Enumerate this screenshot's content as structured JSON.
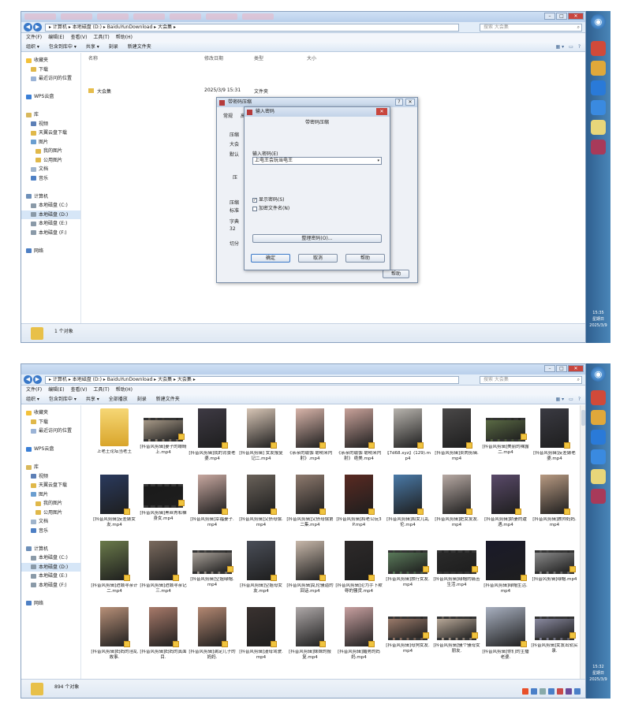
{
  "screen1": {
    "address": "▸ 计算机 ▸ 本地磁盘 (D:) ▸ BaiduYunDownload ▸ 大会集 ▸",
    "search_placeholder": "搜索 大会集",
    "menu": [
      "文件(F)",
      "编辑(E)",
      "查看(V)",
      "工具(T)",
      "帮助(H)"
    ],
    "toolbar": [
      "组织 ▾",
      "包含到库中 ▾",
      "共享 ▾",
      "刻录",
      "新建文件夹"
    ],
    "sidebar": [
      {
        "label": "收藏夹",
        "icon": "star-icon",
        "color": "#f3c13a"
      },
      {
        "label": "下载",
        "icon": "download-folder-icon",
        "color": "#e0b84a",
        "indent": true
      },
      {
        "label": "最近访问的位置",
        "icon": "recent-icon",
        "color": "#9ab3d6",
        "indent": true
      },
      {
        "label": "",
        "icon": "",
        "color": ""
      },
      {
        "label": "WPS云盘",
        "icon": "cloud-icon",
        "color": "#3a7fd6"
      },
      {
        "label": "",
        "icon": "",
        "color": ""
      },
      {
        "label": "库",
        "icon": "library-icon",
        "color": "#d8b85c"
      },
      {
        "label": "视频",
        "icon": "video-icon",
        "color": "#5c7fb6",
        "indent": true
      },
      {
        "label": "天翼云盘下载",
        "icon": "cloud-download-icon",
        "color": "#e0b84a",
        "indent": true
      },
      {
        "label": "图片",
        "icon": "picture-icon",
        "color": "#6a9ed0",
        "indent": true
      },
      {
        "label": "我的图片",
        "icon": "picture-folder-icon",
        "color": "#e0b84a",
        "indent2": true
      },
      {
        "label": "公用图片",
        "icon": "picture-folder-icon",
        "color": "#e0b84a",
        "indent2": true
      },
      {
        "label": "文档",
        "icon": "document-icon",
        "color": "#9fb4cc",
        "indent": true
      },
      {
        "label": "音乐",
        "icon": "music-icon",
        "color": "#4d7fc4",
        "indent": true
      },
      {
        "label": "",
        "icon": "",
        "color": ""
      },
      {
        "label": "计算机",
        "icon": "computer-icon",
        "color": "#6d8fb8"
      },
      {
        "label": "本地磁盘 (C:)",
        "icon": "drive-icon",
        "color": "#8a9aa8",
        "indent": true
      },
      {
        "label": "本地磁盘 (D:)",
        "icon": "drive-icon",
        "color": "#8a9aa8",
        "indent": true,
        "selected": true
      },
      {
        "label": "本地磁盘 (E:)",
        "icon": "drive-icon",
        "color": "#8a9aa8",
        "indent": true
      },
      {
        "label": "本地磁盘 (F:)",
        "icon": "drive-icon",
        "color": "#8a9aa8",
        "indent": true
      },
      {
        "label": "",
        "icon": "",
        "color": ""
      },
      {
        "label": "网络",
        "icon": "network-icon",
        "color": "#4d7fc4"
      }
    ],
    "columns": {
      "name": "名称",
      "date": "修改日期",
      "type": "类型",
      "size": "大小"
    },
    "row": {
      "name": "大会集",
      "date": "2025/3/9 15:31",
      "type": "文件夹"
    },
    "status": "1 个对象",
    "clock": {
      "time": "15:35",
      "day": "星期日",
      "date": "2025/3/9"
    },
    "dialog_back": {
      "title": "带密码压缩",
      "tab_general": "常规",
      "tab_advanced": "高",
      "labels": [
        "压缩",
        "大会",
        "默认",
        "压",
        "压缩",
        "标准",
        "字典",
        "32",
        "切分"
      ],
      "help": "帮助"
    },
    "dialog": {
      "title": "输入密码",
      "heading": "带密码压缩",
      "password_label": "输入密码(E)",
      "password_value": "上电王会玩当电王",
      "show_password": "显示密码(S)",
      "encrypt_names": "加密文件名(N)",
      "organize": "整理密码(O)...",
      "ok": "确定",
      "cancel": "取消",
      "help": "帮助"
    }
  },
  "screen2": {
    "address": "▸ 计算机 ▸ 本地磁盘 (D:) ▸ BaiduYunDownload ▸ 大会集 ▸ 大会集 ▸",
    "search_placeholder": "搜索 大会集",
    "menu": [
      "文件(F)",
      "编辑(E)",
      "查看(V)",
      "工具(T)",
      "帮助(H)"
    ],
    "toolbar": [
      "组织 ▾",
      "包含到库中 ▾",
      "共享 ▾",
      "全部播放",
      "刻录",
      "新建文件夹"
    ],
    "status": "894 个对象",
    "clock": {
      "time": "15:32",
      "day": "星期日",
      "date": "2025/3/9"
    },
    "files": [
      {
        "name": "上老王论坛当老王",
        "kind": "folder",
        "color": ""
      },
      {
        "name": "[抖音风剪辑]妻子的眼睛上.mp4",
        "kind": "wide",
        "color": "#a89a88"
      },
      {
        "name": "[抖音风剪辑]我的背景老婆.mp4",
        "kind": "tall",
        "color": "#3e3a44"
      },
      {
        "name": "[抖音风剪辑] 女友报复记二.mp4",
        "kind": "tall",
        "color": "#d8c6b6"
      },
      {
        "name": "《亲亲的瑜伽 聪明来内射》.mp4",
        "kind": "tall",
        "color": "#d9b5aa"
      },
      {
        "name": "《亲亲的瑜伽 聪明来内射》 绝美.mp4",
        "kind": "tall",
        "color": "#c9a29a"
      },
      {
        "name": "【7d68.xyz】(129).mp4",
        "kind": "tall",
        "color": "#b8b4ae"
      },
      {
        "name": "[抖音风剪辑]卖肉剪辑.mp4",
        "kind": "tall",
        "color": "#4a4848"
      },
      {
        "name": "[抖音风剪辑]美丽的裸露二.mp4",
        "kind": "wide",
        "color": "#5a6a44"
      },
      {
        "name": "[抖音风剪辑]反差婊老婆.mp4",
        "kind": "tall",
        "color": "#3a3a42"
      },
      {
        "name": "[抖音风剪辑]反差婊女友.mp4",
        "kind": "tall",
        "color": "#2a3a5e"
      },
      {
        "name": "[抖音风剪辑]黑丝秀和裸身女.mp4",
        "kind": "wide",
        "color": "#1a1a1a"
      },
      {
        "name": "[抖音风剪辑]幸福妻子.mp4",
        "kind": "tall",
        "color": "#c8a8a0"
      },
      {
        "name": "[抖音风剪辑]父债母偿.mp4",
        "kind": "tall",
        "color": "#6a625a"
      },
      {
        "name": "[抖音风剪辑]父债母偿第二集.mp4",
        "kind": "tall",
        "color": "#8e7a6e"
      },
      {
        "name": "[抖音风剪辑]和老公玩3P.mp4",
        "kind": "tall",
        "color": "#5a2a22"
      },
      {
        "name": "[抖音风剪辑]和女儿乱伦.mp4",
        "kind": "tall",
        "color": "#4a7aa8"
      },
      {
        "name": "[抖音风剪辑]肥女友友.mp4",
        "kind": "tall",
        "color": "#b8aaa4"
      },
      {
        "name": "[抖音风剪辑]娇妻的遭遇.mp4",
        "kind": "tall",
        "color": "#5a4a6a"
      },
      {
        "name": "[抖音风剪辑]教师妈妈.mp4",
        "kind": "tall",
        "color": "#b89a82"
      },
      {
        "name": "[抖音风剪辑]进城寻亲计二.mp4",
        "kind": "tall",
        "color": "#6a7a4a"
      },
      {
        "name": "[抖音风剪辑]进城寻亲记三.mp4",
        "kind": "tall",
        "color": "#7a6a5e"
      },
      {
        "name": "[抖音风剪辑]空姐绿帽.mp4",
        "kind": "wide",
        "color": "#a8a098"
      },
      {
        "name": "[抖音风剪辑]空姐母女友.mp4",
        "kind": "tall",
        "color": "#4a4e58"
      },
      {
        "name": "[抖音风剪辑]乱伦骚逼的回话.mp4",
        "kind": "tall",
        "color": "#c8b8aa"
      },
      {
        "name": "[抖音风剪辑]沦为手下欺辱的骚货.mp4",
        "kind": "tall",
        "color": "#2e2a2a"
      },
      {
        "name": "[抖音风剪辑]旅行女友.mp4",
        "kind": "wide",
        "color": "#5a7a5a"
      },
      {
        "name": "[抖音风剪辑]绿帽的痛苦生活.mp4",
        "kind": "wide",
        "color": "#2a2a2a"
      },
      {
        "name": "[抖音风剪辑]绿帽生活.mp4",
        "kind": "sq",
        "color": "#1a1a2a"
      },
      {
        "name": "[抖音风剪辑]绿帽.mp4",
        "kind": "wide",
        "color": "#8a8a8a"
      },
      {
        "name": "[抖音风剪辑]妈妈的淫乱故事.",
        "kind": "tall",
        "color": "#b89078"
      },
      {
        "name": "[抖音风剪辑]妈妈的真面目.",
        "kind": "tall",
        "color": "#a87a6a"
      },
      {
        "name": "[抖音风剪辑]满足儿子的妈妈.",
        "kind": "tall",
        "color": "#b48872"
      },
      {
        "name": "[抖音风剪辑]漫母驾驶.mp4",
        "kind": "tall",
        "color": "#3a3230"
      },
      {
        "name": "[抖音风剪辑]妹妹的报复.mp4",
        "kind": "tall",
        "color": "#aea8a8"
      },
      {
        "name": "[抖音风剪辑]媚男的妈妈.mp4",
        "kind": "tall",
        "color": "#c8a0a0"
      },
      {
        "name": "[抖音风剪辑]母狗女友.mp4",
        "kind": "wide",
        "color": "#9a7a6a"
      },
      {
        "name": "[抖音风剪辑]骚个骚母女朋友.",
        "kind": "wide",
        "color": "#b8a898"
      },
      {
        "name": "[抖音风剪辑]你们的主播老婆.",
        "kind": "sq",
        "color": "#a8b0c0"
      },
      {
        "name": "[抖音风剪辑]女友出轨实录.",
        "kind": "wide",
        "color": "#8a8aa0"
      }
    ]
  },
  "dock": [
    {
      "name": "chrome-dock-1",
      "icon": "chrome-icon",
      "color": "#d04a3a"
    },
    {
      "name": "chrome-dock-2",
      "icon": "chrome-icon",
      "color": "#e0a83a"
    },
    {
      "name": "baidu-netdisk",
      "icon": "netdisk-icon",
      "color": "#2a7ad8"
    },
    {
      "name": "feishu",
      "icon": "send-icon",
      "color": "#3a8ae0"
    },
    {
      "name": "notes",
      "icon": "notes-icon",
      "color": "#e8d67a"
    },
    {
      "name": "winrar",
      "icon": "winrar-icon",
      "color": "#a83a5a"
    }
  ]
}
